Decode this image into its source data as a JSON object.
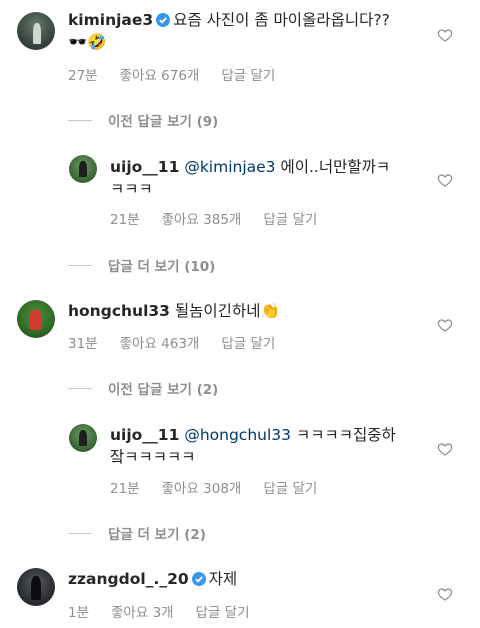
{
  "comments": [
    {
      "username": "kiminjae3",
      "text": "요즘 사진이 좀 마이올라옵니다??",
      "text2": "🕶️🤣",
      "time": "27분",
      "likes": "좋아요 676개",
      "reply": "답글 달기",
      "view_replies": "이전 답글 보기 (9)"
    },
    {
      "username": "uijo__11",
      "mention": "@kiminjae3",
      "text": "에이..너만할까ㅋ",
      "text2": "ㅋㅋㅋ",
      "time": "21분",
      "likes": "좋아요 385개",
      "reply": "답글 달기",
      "more_replies": "답글 더 보기 (10)"
    },
    {
      "username": "hongchul33",
      "text": "될놈이긴하네👏",
      "time": "31분",
      "likes": "좋아요 463개",
      "reply": "답글 달기",
      "view_replies": "이전 답글 보기 (2)"
    },
    {
      "username": "uijo__11",
      "mention": "@hongchul33",
      "text": "ㅋㅋㅋㅋ집중하",
      "text2": "잨ㅋㅋㅋㅋㅋ",
      "time": "21분",
      "likes": "좋아요 308개",
      "reply": "답글 달기",
      "more_replies": "답글 더 보기 (2)"
    },
    {
      "username": "zzangdol_._20",
      "text": "자제",
      "time": "1분",
      "likes": "좋아요 3개",
      "reply": "답글 달기"
    }
  ],
  "colors": {
    "verified": "#3897f0",
    "meta": "#8e8e8e",
    "mention": "#00376b"
  }
}
